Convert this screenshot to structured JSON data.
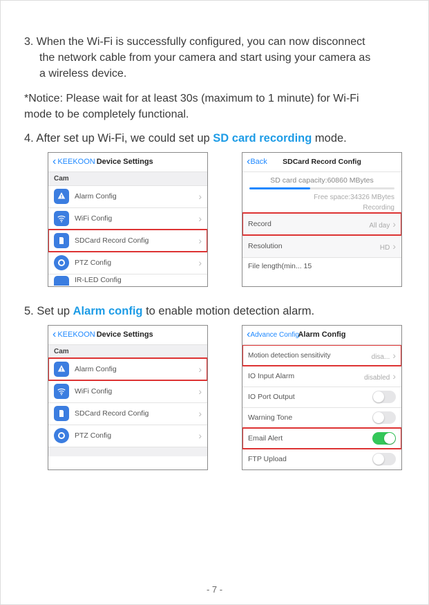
{
  "step3": {
    "line1": "3. When the Wi-Fi is successfully configured, you can now disconnect",
    "line2": "the network cable from your camera and start using your camera as",
    "line3": "a wireless device."
  },
  "notice": {
    "line1": "*Notice: Please wait for at least 30s (maximum to 1 minute) for Wi-Fi",
    "line2": "mode to be completely functional."
  },
  "step4": {
    "prefix": "4. After set up Wi-Fi, we could set up ",
    "emph": "SD card recording",
    "suffix": " mode."
  },
  "step5": {
    "prefix": "5. Set up ",
    "emph": "Alarm config",
    "suffix": " to enable motion detection alarm."
  },
  "shotA": {
    "back": "KEEKOON",
    "title": "Device Settings",
    "section": "Cam",
    "rows": {
      "alarm": "Alarm Config",
      "wifi": "WiFi Config",
      "sd": "SDCard Record Config",
      "ptz": "PTZ Config",
      "ir": "IR-LED Config"
    }
  },
  "shotB": {
    "back": "Back",
    "title": "SDCard Record Config",
    "capacity": "SD card capacity:60860 MBytes",
    "free": "Free space:34326 MBytes",
    "status": "Recording",
    "record_label": "Record",
    "record_val": "All day",
    "resolution_label": "Resolution",
    "resolution_val": "HD",
    "filelen": "File length(min... 15"
  },
  "shotC": {
    "back": "KEEKOON",
    "title": "Device Settings",
    "section": "Cam",
    "rows": {
      "alarm": "Alarm Config",
      "wifi": "WiFi Config",
      "sd": "SDCard Record Config",
      "ptz": "PTZ Config"
    }
  },
  "shotD": {
    "back": "Advance Config",
    "title": "Alarm Config",
    "motion_label": "Motion detection sensitivity",
    "motion_val": "disa...",
    "ioin_label": "IO Input Alarm",
    "ioin_val": "disabled",
    "ioport": "IO Port Output",
    "warn": "Warning Tone",
    "email": "Email Alert",
    "ftp": "FTP Upload"
  },
  "page_number": "- 7 -"
}
